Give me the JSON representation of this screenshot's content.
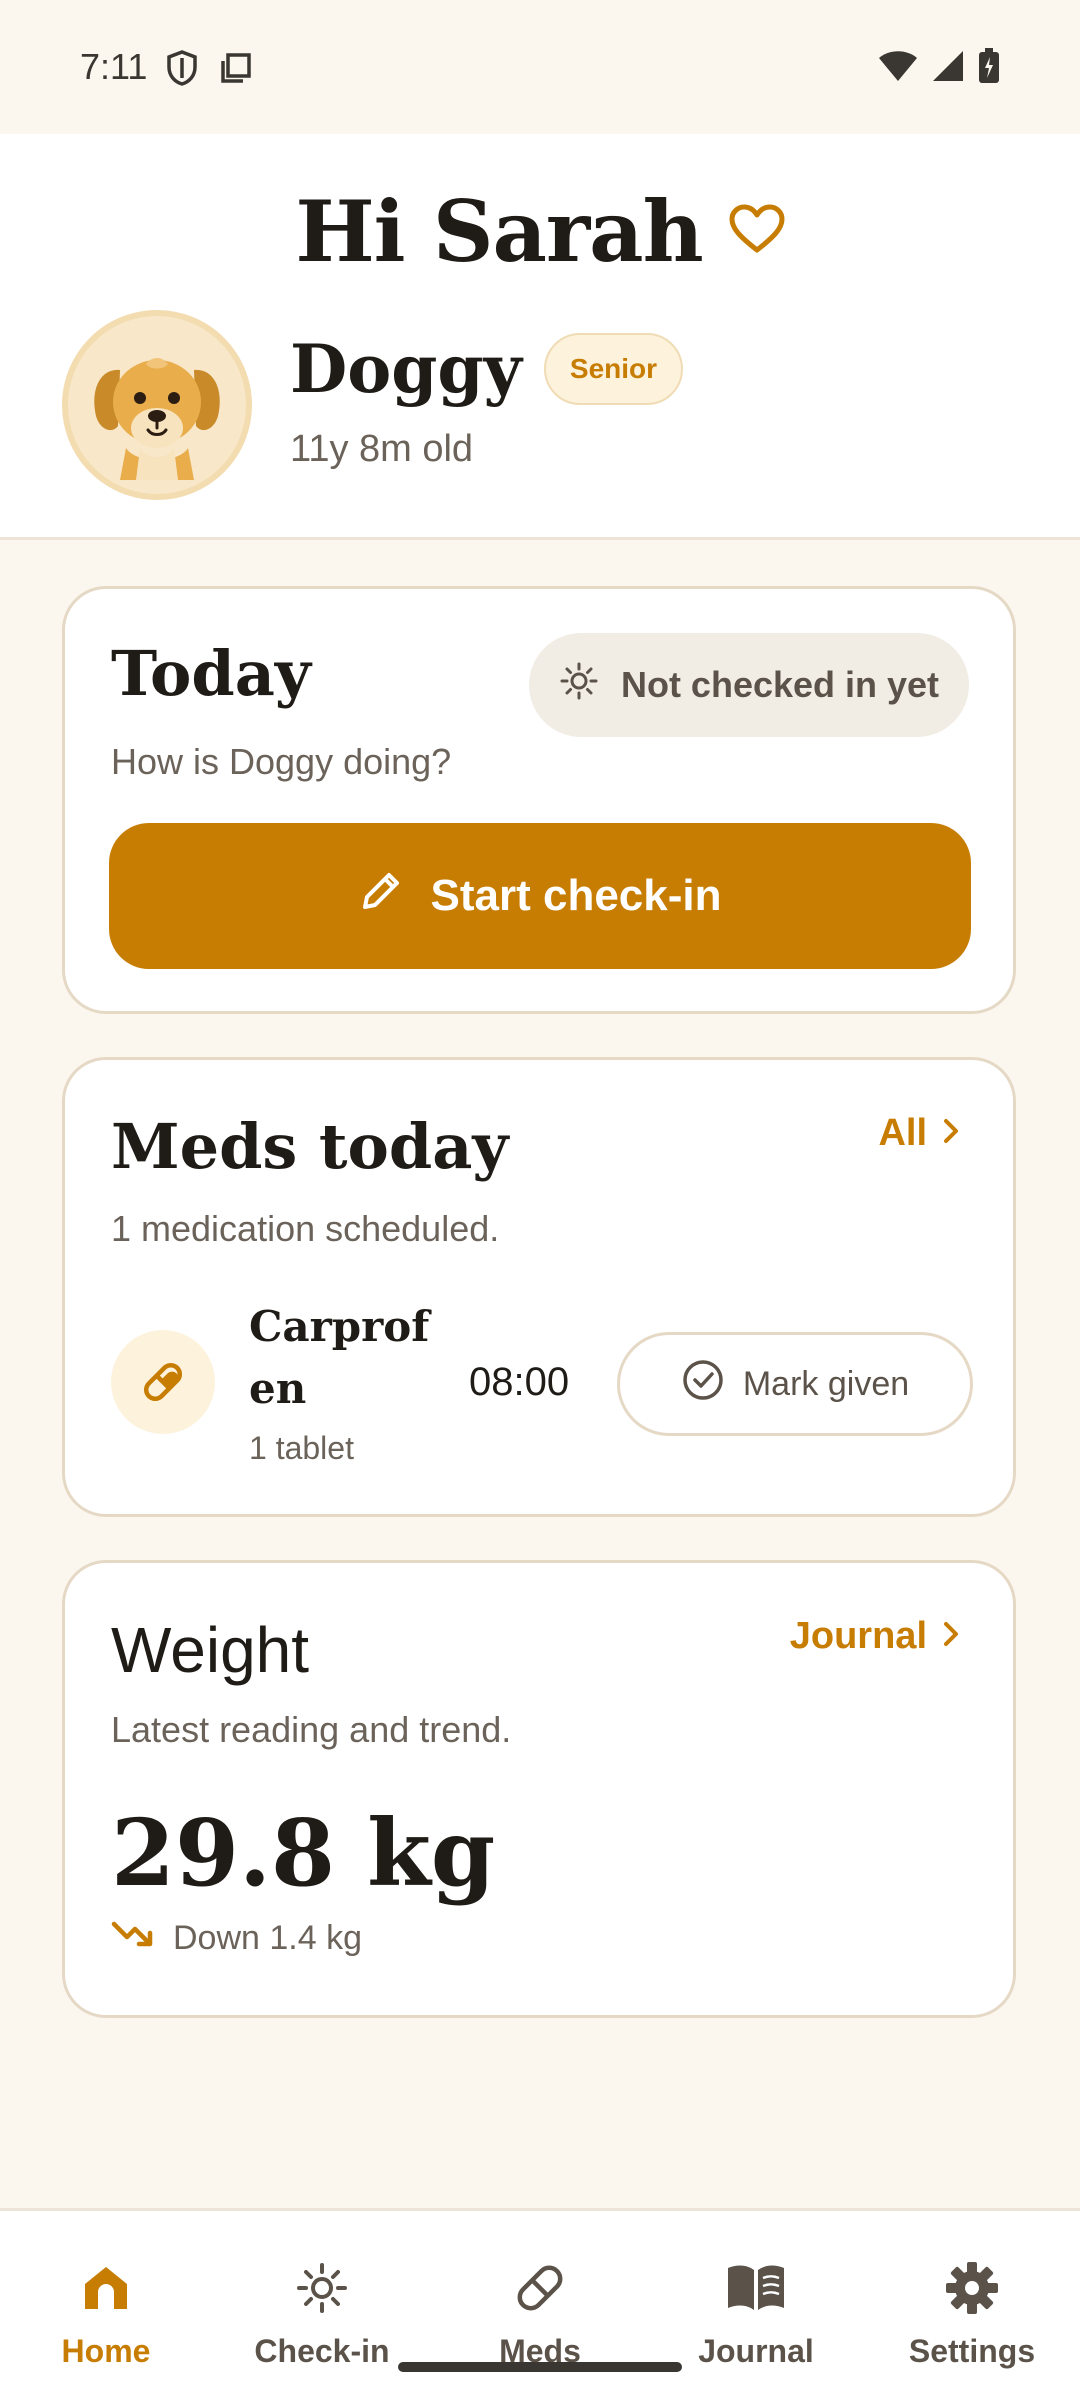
{
  "status_bar": {
    "time": "7:11"
  },
  "header": {
    "greeting": "Hi Sarah",
    "pet_name": "Doggy",
    "badge": "Senior",
    "age": "11y 8m old"
  },
  "today_card": {
    "title": "Today",
    "subtitle": "How is Doggy doing?",
    "status_chip": "Not checked in yet",
    "start_button": "Start check-in"
  },
  "meds_card": {
    "title": "Meds today",
    "link": "All",
    "subtitle": "1 medication scheduled.",
    "medication": {
      "name": "Carprofen",
      "dose": "1 tablet",
      "time": "08:00",
      "button": "Mark given"
    }
  },
  "weight_card": {
    "title": "Weight",
    "link": "Journal",
    "subtitle": "Latest reading and trend.",
    "value": "29.8 kg",
    "trend": "Down 1.4 kg"
  },
  "bottom_nav": {
    "items": [
      {
        "label": "Home",
        "icon": "home-icon",
        "active": true
      },
      {
        "label": "Check-in",
        "icon": "checkin-icon",
        "active": false
      },
      {
        "label": "Meds",
        "icon": "pill-icon",
        "active": false
      },
      {
        "label": "Journal",
        "icon": "book-icon",
        "active": false
      },
      {
        "label": "Settings",
        "icon": "gear-icon",
        "active": false
      }
    ]
  },
  "colors": {
    "accent": "#c77c02",
    "background": "#fbf7ef",
    "card": "#ffffff",
    "border": "#e5d9c6",
    "muted_text": "#6b635a"
  }
}
